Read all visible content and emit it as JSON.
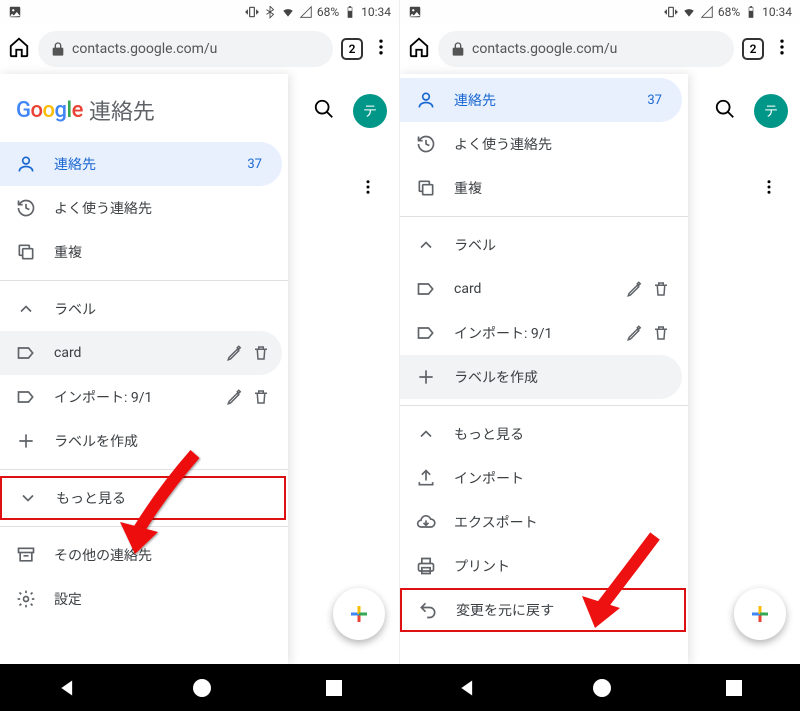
{
  "status": {
    "battery": "68%",
    "time": "10:34"
  },
  "browser": {
    "url": "contacts.google.com/u",
    "tabs": "2"
  },
  "brand": {
    "app": "連絡先"
  },
  "avatar_initial": "テ",
  "left": {
    "contacts": {
      "label": "連絡先",
      "count": "37"
    },
    "frequent": "よく使う連絡先",
    "duplicates": "重複",
    "labels_header": "ラベル",
    "label_card": "card",
    "label_import": "インポート: 9/1",
    "create_label": "ラベルを作成",
    "see_more": "もっと見る",
    "other_contacts": "その他の連絡先",
    "settings": "設定"
  },
  "right": {
    "contacts": {
      "label": "連絡先",
      "count": "37"
    },
    "frequent": "よく使う連絡先",
    "duplicates": "重複",
    "labels_header": "ラベル",
    "label_card": "card",
    "label_import": "インポート: 9/1",
    "create_label": "ラベルを作成",
    "see_more": "もっと見る",
    "import": "インポート",
    "export": "エクスポート",
    "print": "プリント",
    "undo": "変更を元に戻す"
  }
}
